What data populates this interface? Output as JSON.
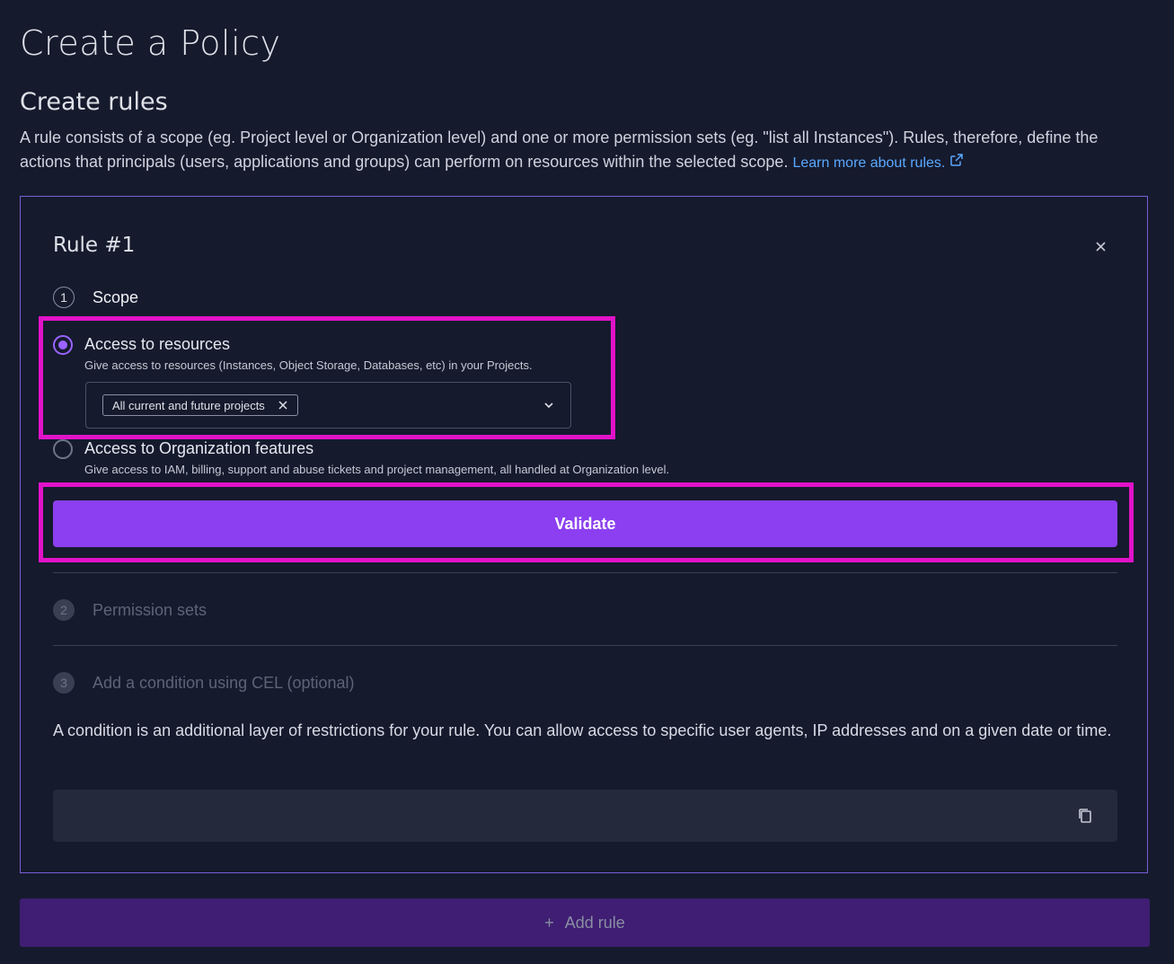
{
  "page": {
    "title": "Create a Policy"
  },
  "rules_section": {
    "title": "Create rules",
    "description": "A rule consists of a scope (eg. Project level or Organization level) and one or more permission sets (eg. \"list all Instances\"). Rules, therefore, define the actions that principals (users, applications and groups) can perform on resources within the selected scope.",
    "learn_more_link": "Learn more about rules."
  },
  "rule": {
    "title": "Rule #1",
    "steps": [
      {
        "number": "1",
        "label": "Scope",
        "state": "active"
      },
      {
        "number": "2",
        "label": "Permission sets",
        "state": "inactive"
      },
      {
        "number": "3",
        "label": "Add a condition using CEL (optional)",
        "state": "inactive"
      }
    ],
    "scope_options": [
      {
        "label": "Access to resources",
        "description": "Give access to resources (Instances, Object Storage, Databases, etc) in your Projects.",
        "selected": true
      },
      {
        "label": "Access to Organization features",
        "description": "Give access to IAM, billing, support and abuse tickets and project management, all handled at Organization level.",
        "selected": false
      }
    ],
    "project_select": {
      "selected_tags": [
        "All current and future projects"
      ]
    },
    "validate_label": "Validate",
    "condition_description": "A condition is an additional layer of restrictions for your rule. You can allow access to specific user agents, IP addresses and on a given date or time.",
    "condition_value": ""
  },
  "add_rule_label": "Add rule",
  "icons": [
    "external-link-icon",
    "close-icon",
    "tag-remove-icon",
    "chevron-down-icon",
    "copy-icon",
    "plus-icon"
  ],
  "colors": {
    "background": "#151a2d",
    "accent": "#8b3ff0",
    "link": "#5aa8ff",
    "highlight": "#e113c8",
    "card_border": "#7b5fd6",
    "add_rule_bg": "#3f1e73"
  }
}
